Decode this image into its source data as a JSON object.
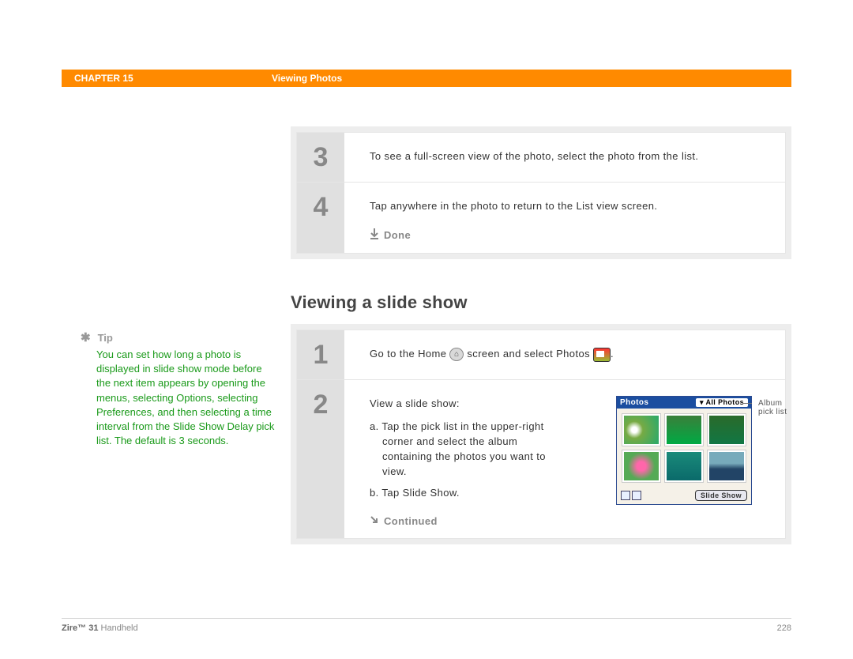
{
  "header": {
    "chapter": "CHAPTER 15",
    "title": "Viewing Photos"
  },
  "tip": {
    "label": "Tip",
    "body": "You can set how long a photo is displayed in slide show mode before the next item appears by opening the menus, selecting Options, selecting Preferences, and then selecting a time interval from the Slide Show Delay pick list. The default is 3 seconds."
  },
  "topSteps": {
    "s3": {
      "num": "3",
      "text": "To see a full-screen view of the photo, select the photo from the list."
    },
    "s4": {
      "num": "4",
      "text": "Tap anywhere in the photo to return to the List view screen.",
      "done": "Done"
    }
  },
  "sectionTitle": "Viewing a slide show",
  "slideSteps": {
    "s1": {
      "num": "1",
      "text_a": "Go to the Home",
      "text_b": "screen and select Photos",
      "text_c": "."
    },
    "s2": {
      "num": "2",
      "lead": "View a slide show:",
      "a": "a. Tap the pick list in the upper-right corner and select the album containing the photos you want to view.",
      "b": "b. Tap Slide Show.",
      "continued": "Continued"
    }
  },
  "device": {
    "title": "Photos",
    "picker": "All Photos",
    "button": "Slide Show",
    "callout": "Album pick list"
  },
  "footer": {
    "product_bold": "Zire™ 31",
    "product_rest": " Handheld",
    "page": "228"
  }
}
